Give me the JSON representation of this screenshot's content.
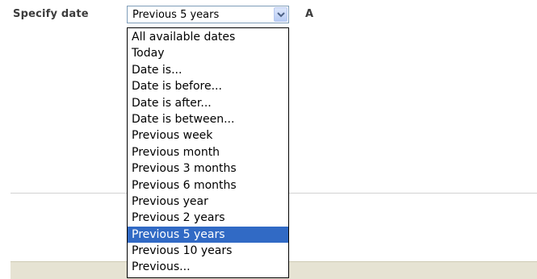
{
  "form": {
    "label": "Specify date",
    "trailing_label": "A"
  },
  "date_select": {
    "selected_value": "Previous 5 years",
    "selected_index": 12,
    "options": [
      "All available dates",
      "Today",
      "Date is...",
      "Date is before...",
      "Date is after...",
      "Date is between...",
      "Previous week",
      "Previous month",
      "Previous 3 months",
      "Previous 6 months",
      "Previous year",
      "Previous 2 years",
      "Previous 5 years",
      "Previous 10 years",
      "Previous..."
    ],
    "arrow_icon": "chevron-down-icon"
  },
  "colors": {
    "highlight": "#316ac5",
    "select_border": "#7f9db9",
    "footer_bar": "#e6e3d3"
  }
}
